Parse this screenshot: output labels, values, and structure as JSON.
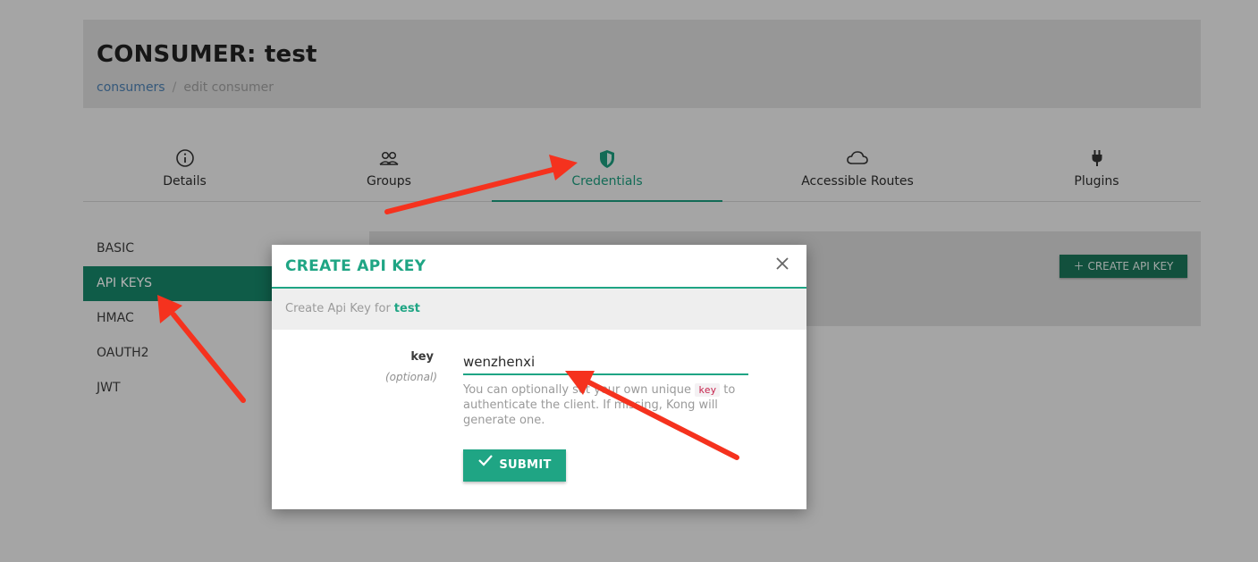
{
  "header": {
    "title": "CONSUMER: test",
    "breadcrumb": {
      "link": "consumers",
      "separator": "/",
      "current": "edit consumer"
    }
  },
  "tabs": [
    {
      "label": "Details",
      "icon": "info-icon"
    },
    {
      "label": "Groups",
      "icon": "users-icon"
    },
    {
      "label": "Credentials",
      "icon": "shield-icon",
      "active": true
    },
    {
      "label": "Accessible Routes",
      "icon": "cloud-icon"
    },
    {
      "label": "Plugins",
      "icon": "plug-icon"
    }
  ],
  "sidebar": {
    "items": [
      {
        "label": "BASIC"
      },
      {
        "label": "API KEYS",
        "active": true
      },
      {
        "label": "HMAC"
      },
      {
        "label": "OAUTH2"
      },
      {
        "label": "JWT"
      }
    ]
  },
  "panel": {
    "create_button": "CREATE API KEY",
    "create_icon": "plus-icon"
  },
  "modal": {
    "title": "CREATE API KEY",
    "close_icon": "close-icon",
    "subtitle": "Create Api Key for",
    "subtitle_name": "test",
    "field_label": "key",
    "field_optional": "(optional)",
    "key_value": "wenzhenxi",
    "help_before": "You can optionally set your own unique",
    "help_code": "key",
    "help_after": "to authenticate the client. If missing, Kong will generate one.",
    "submit_label": "SUBMIT",
    "submit_icon": "check-icon"
  },
  "colors": {
    "accent": "#1fa584",
    "sidebar_active": "#168467",
    "annotation_arrow": "#f5321e"
  }
}
